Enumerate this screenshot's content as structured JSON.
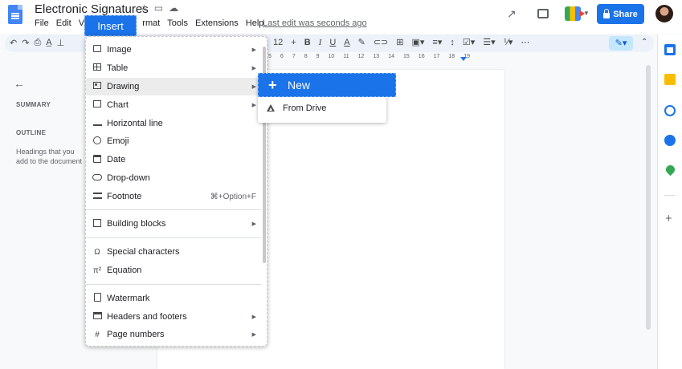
{
  "app": {
    "doc_title": "Electronic Signatures",
    "last_edit": "Last edit was seconds ago",
    "share_label": "Share"
  },
  "menubar": {
    "items": [
      "File",
      "Edit",
      "View",
      "Insert",
      "Format",
      "Tools",
      "Extensions",
      "Help"
    ],
    "active": "Insert"
  },
  "toolbar": {
    "font_size": "12",
    "bold": "B",
    "italic": "I",
    "underline": "U",
    "text_color": "A"
  },
  "ruler": {
    "ticks": [
      "5",
      "6",
      "7",
      "8",
      "9",
      "10",
      "11",
      "12",
      "13",
      "14",
      "15",
      "16",
      "17",
      "18",
      "19"
    ]
  },
  "sidebar": {
    "summary_label": "SUMMARY",
    "outline_label": "OUTLINE",
    "outline_hint": "Headings that you add to the document will appear here."
  },
  "insert_menu": {
    "items": [
      {
        "label": "Image",
        "icon": "image-icon",
        "submenu": true
      },
      {
        "label": "Table",
        "icon": "table-icon",
        "submenu": true
      },
      {
        "label": "Drawing",
        "icon": "drawing-icon",
        "submenu": true,
        "highlighted": true
      },
      {
        "label": "Chart",
        "icon": "chart-icon",
        "submenu": true
      },
      {
        "label": "Horizontal line",
        "icon": "horizontal-line-icon"
      },
      {
        "label": "Emoji",
        "icon": "emoji-icon"
      },
      {
        "label": "Date",
        "icon": "date-icon"
      },
      {
        "label": "Drop-down",
        "icon": "dropdown-icon"
      },
      {
        "label": "Footnote",
        "icon": "footnote-icon",
        "shortcut": "⌘+Option+F"
      },
      {
        "label": "Building blocks",
        "icon": "building-blocks-icon",
        "submenu": true
      },
      {
        "label": "Special characters",
        "icon": "omega-icon"
      },
      {
        "label": "Equation",
        "icon": "pi-icon"
      },
      {
        "label": "Watermark",
        "icon": "watermark-icon"
      },
      {
        "label": "Headers and footers",
        "icon": "headers-footers-icon",
        "submenu": true
      },
      {
        "label": "Page numbers",
        "icon": "hash-icon",
        "submenu": true
      }
    ]
  },
  "drawing_submenu": {
    "new_label": "New",
    "from_drive_label": "From Drive"
  },
  "colors": {
    "accent": "#1a73e8",
    "menu_highlight": "#ececec",
    "toolbar_bg": "#edf2fa"
  }
}
